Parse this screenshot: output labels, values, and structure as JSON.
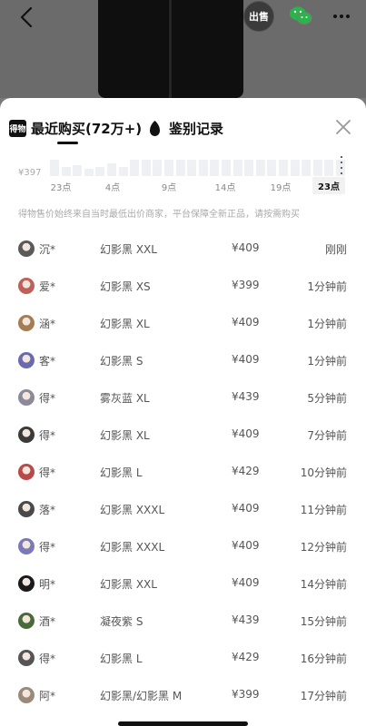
{
  "header": {
    "back_icon": "chevron-left-icon",
    "sell_label": "出售",
    "wechat_icon": "wechat-icon",
    "more_icon": "more-dots-icon"
  },
  "sheet": {
    "logo_text": "得物",
    "tab_recent_label": "最近购买(72万+)",
    "tab_auth_label": "鉴别记录",
    "close_icon": "close-icon"
  },
  "chart": {
    "y_label": "¥397",
    "ticks": [
      "23点",
      "4点",
      "9点",
      "14点",
      "19点",
      "23点"
    ],
    "active_tick": "23点"
  },
  "disclaimer": "得物售价始终来自当时最低出价商家，平台保障全新正品，请按需购买",
  "records": [
    {
      "user": "沉*",
      "spec": "幻影黑 XXL",
      "price": "¥409",
      "time": "刚刚",
      "avatar_color": "#5a5a5a"
    },
    {
      "user": "爱*",
      "spec": "幻影黑 XS",
      "price": "¥399",
      "time": "1分钟前",
      "avatar_color": "#c0605a"
    },
    {
      "user": "涵*",
      "spec": "幻影黑 XL",
      "price": "¥409",
      "time": "1分钟前",
      "avatar_color": "#a67c52"
    },
    {
      "user": "客*",
      "spec": "幻影黑 S",
      "price": "¥409",
      "time": "1分钟前",
      "avatar_color": "#6a6ab0"
    },
    {
      "user": "得*",
      "spec": "雾灰蓝 XL",
      "price": "¥439",
      "time": "5分钟前",
      "avatar_color": "#8a8a9a"
    },
    {
      "user": "得*",
      "spec": "幻影黑 XL",
      "price": "¥409",
      "time": "7分钟前",
      "avatar_color": "#3a3a3a"
    },
    {
      "user": "得*",
      "spec": "幻影黑 L",
      "price": "¥429",
      "time": "10分钟前",
      "avatar_color": "#b84a4a"
    },
    {
      "user": "落*",
      "spec": "幻影黑 XXXL",
      "price": "¥409",
      "time": "11分钟前",
      "avatar_color": "#4a4a4a"
    },
    {
      "user": "得*",
      "spec": "幻影黑 XXXL",
      "price": "¥409",
      "time": "12分钟前",
      "avatar_color": "#7a7ab8"
    },
    {
      "user": "明*",
      "spec": "幻影黑 XXL",
      "price": "¥409",
      "time": "14分钟前",
      "avatar_color": "#1a1a1a"
    },
    {
      "user": "酒*",
      "spec": "凝夜紫 S",
      "price": "¥439",
      "time": "15分钟前",
      "avatar_color": "#4a6a3a"
    },
    {
      "user": "得*",
      "spec": "幻影黑 L",
      "price": "¥429",
      "time": "16分钟前",
      "avatar_color": "#555555"
    },
    {
      "user": "阿*",
      "spec": "幻影黑/幻影黑 M",
      "price": "¥399",
      "time": "17分钟前",
      "avatar_color": "#9a8a7a"
    }
  ]
}
